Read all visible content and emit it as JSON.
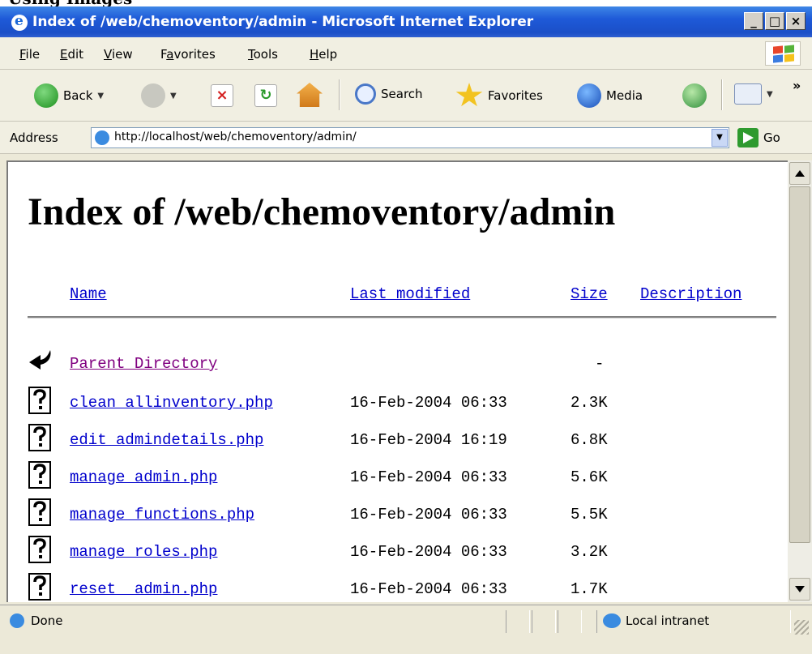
{
  "top_fragment_text": "Using Images",
  "window": {
    "title": "Index of /web/chemoventory/admin - Microsoft Internet Explorer",
    "controls": {
      "minimize": "_",
      "maximize": "□",
      "close": "×"
    }
  },
  "menu": {
    "items": [
      {
        "accel": "F",
        "rest": "ile"
      },
      {
        "accel": "E",
        "rest": "dit"
      },
      {
        "accel": "V",
        "rest": "iew"
      },
      {
        "pre": "F",
        "accel": "a",
        "rest": "vorites"
      },
      {
        "accel": "T",
        "rest": "ools"
      },
      {
        "accel": "H",
        "rest": "elp"
      }
    ]
  },
  "toolbar": {
    "back_label": "Back",
    "search_label": "Search",
    "favorites_label": "Favorites",
    "media_label": "Media",
    "overflow": "»"
  },
  "address": {
    "label": "Address",
    "url": "http://localhost/web/chemoventory/admin/",
    "go_label": "Go"
  },
  "page": {
    "heading": "Index of /web/chemoventory/admin",
    "columns": {
      "name": "Name",
      "modified": "Last modified",
      "size": "Size",
      "description": "Description"
    },
    "parent": {
      "name": "Parent Directory",
      "size": "-"
    },
    "files": [
      {
        "name": "clean_allinventory.php",
        "modified": "16-Feb-2004 06:33",
        "size": "2.3K"
      },
      {
        "name": "edit_admindetails.php",
        "modified": "16-Feb-2004 16:19",
        "size": "6.8K"
      },
      {
        "name": "manage_admin.php",
        "modified": "16-Feb-2004 06:33",
        "size": "5.6K"
      },
      {
        "name": "manage_functions.php",
        "modified": "16-Feb-2004 06:33",
        "size": "5.5K"
      },
      {
        "name": "manage_roles.php",
        "modified": "16-Feb-2004 06:33",
        "size": "3.2K"
      },
      {
        "name": "reset__admin.php",
        "modified": "16-Feb-2004 06:33",
        "size": "1.7K"
      }
    ]
  },
  "status": {
    "text": "Done",
    "zone": "Local intranet"
  },
  "colors": {
    "link": "#0000cc",
    "visited": "#800080",
    "titlebar": "#1e5ad8"
  },
  "icons": {
    "title": "ie-logo-icon",
    "parent": "back-arrow-icon",
    "file": "unknown-file-icon",
    "zone": "globe-icon"
  }
}
